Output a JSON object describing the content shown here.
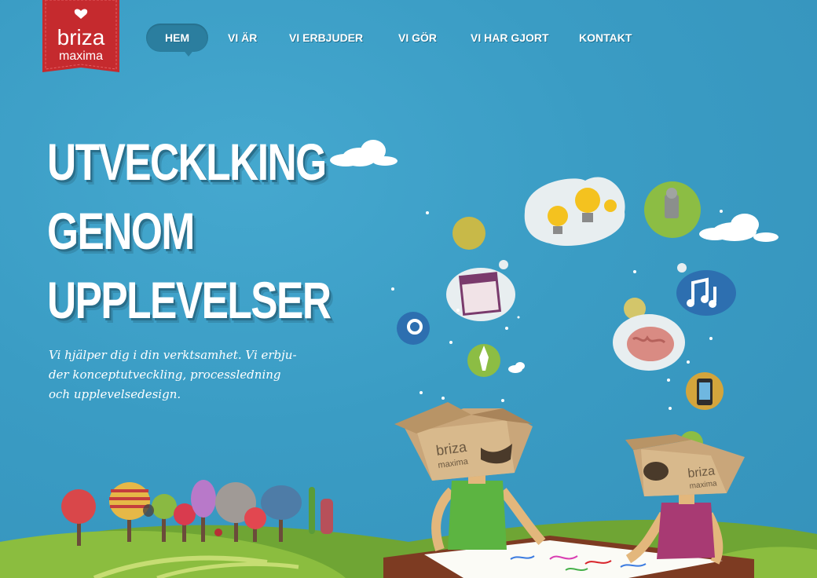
{
  "brand": {
    "name_line1": "briza",
    "name_line2": "maxima",
    "color": "#c52a2e"
  },
  "nav": {
    "items": [
      {
        "label": "HEM",
        "active": true
      },
      {
        "label": "VI ÄR",
        "active": false
      },
      {
        "label": "VI ERBJUDER",
        "active": false
      },
      {
        "label": "VI GÖR",
        "active": false
      },
      {
        "label": "VI HAR GJORT",
        "active": false
      },
      {
        "label": "KONTAKT",
        "active": false
      }
    ]
  },
  "hero": {
    "headline": [
      "UTVECKLKING",
      "GENOM",
      "UPPLEVELSER"
    ],
    "intro_lines": [
      "Vi hjälper dig i din verktsamhet. Vi erbju-",
      "der konceptutveckling, processledning",
      "och upplevelsedesign."
    ]
  },
  "illustration": {
    "box_labels": [
      {
        "line1": "briza",
        "line2": "maxima"
      },
      {
        "line1": "briza",
        "line2": "maxima"
      }
    ],
    "icons": [
      "lightbulb-icon",
      "robot-icon",
      "calendar-icon",
      "gear-icon",
      "music-notes-icon",
      "brain-icon",
      "rocket-icon",
      "phone-icon",
      "cloud-icon"
    ]
  },
  "colors": {
    "sky": "#3a9ec6",
    "grass": "#7fb03a",
    "accent_red": "#c52a2e"
  }
}
